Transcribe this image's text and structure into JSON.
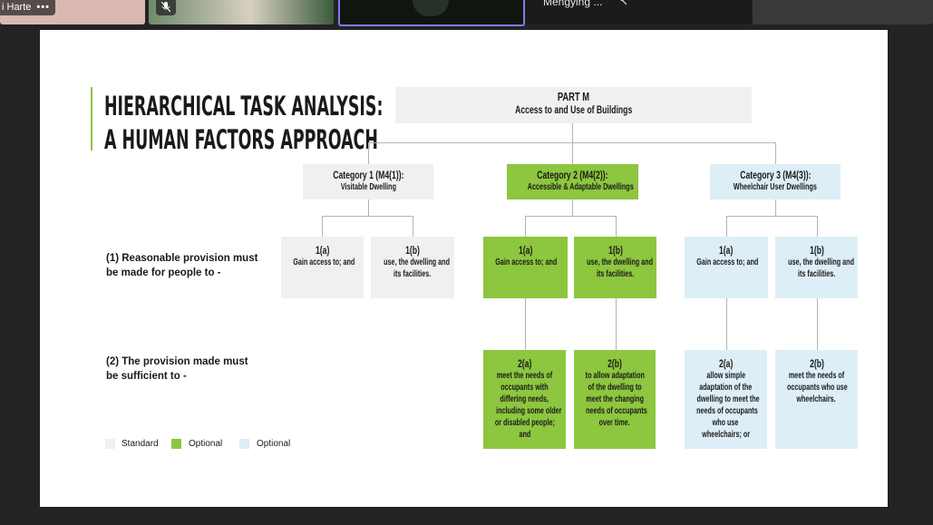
{
  "video_strip": {
    "participant1_name": "i Harte",
    "participant1_more": "•••",
    "participant4_name": "Mengying ...",
    "muted_icon": "mic-off-icon"
  },
  "slide": {
    "title_line1": "HIERARCHICAL TASK ANALYSIS:",
    "title_line2": "A HUMAN FACTORS APPROACH",
    "root": {
      "title": "PART M",
      "subtitle": "Access to and Use of Buildings"
    },
    "categories": [
      {
        "title": "Category 1 (M4(1)):",
        "subtitle": "Visitable Dwelling",
        "a_label": "1(a)",
        "a_text": "Gain access to; and",
        "b_label": "1(b)",
        "b_text_1": "use, the dwelling and",
        "b_text_2": "its facilities."
      },
      {
        "title": "Category 2 (M4(2)):",
        "subtitle": "Accessible & Adaptable Dwellings",
        "a_label": "1(a)",
        "a_text": "Gain access to; and",
        "b_label": "1(b)",
        "b_text_1": "use, the dwelling and",
        "b_text_2": "its facilities.",
        "c_label": "2(a)",
        "c_text": [
          "meet the needs of",
          "occupants with",
          "differing needs,",
          "including some older",
          "or disabled people;",
          "and"
        ],
        "d_label": "2(b)",
        "d_text": [
          "to allow adaptation",
          "of the dwelling to",
          "meet the changing",
          "needs of occupants",
          "over time."
        ]
      },
      {
        "title": "Category 3 (M4(3)):",
        "subtitle": "Wheelchair User Dwellings",
        "a_label": "1(a)",
        "a_text": "Gain access to; and",
        "b_label": "1(b)",
        "b_text_1": "use, the dwelling and",
        "b_text_2": "its facilities.",
        "c_label": "2(a)",
        "c_text": [
          "allow simple",
          "adaptation of the",
          "dwelling to meet the",
          "needs of occupants",
          "who use",
          "wheelchairs; or"
        ],
        "d_label": "2(b)",
        "d_text": [
          "meet the needs of",
          "occupants who use",
          "wheelchairs."
        ]
      }
    ],
    "row1_label_1": "(1) Reasonable provision must",
    "row1_label_2": "be made for people to -",
    "row2_label_1": "(2) The provision made must",
    "row2_label_2": "be sufficient to -",
    "legend": [
      {
        "label": "Standard",
        "color": "#f0f0f0"
      },
      {
        "label": "Optional",
        "color": "#8dc63f"
      },
      {
        "label": "Optional",
        "color": "#ddeef6"
      }
    ]
  }
}
